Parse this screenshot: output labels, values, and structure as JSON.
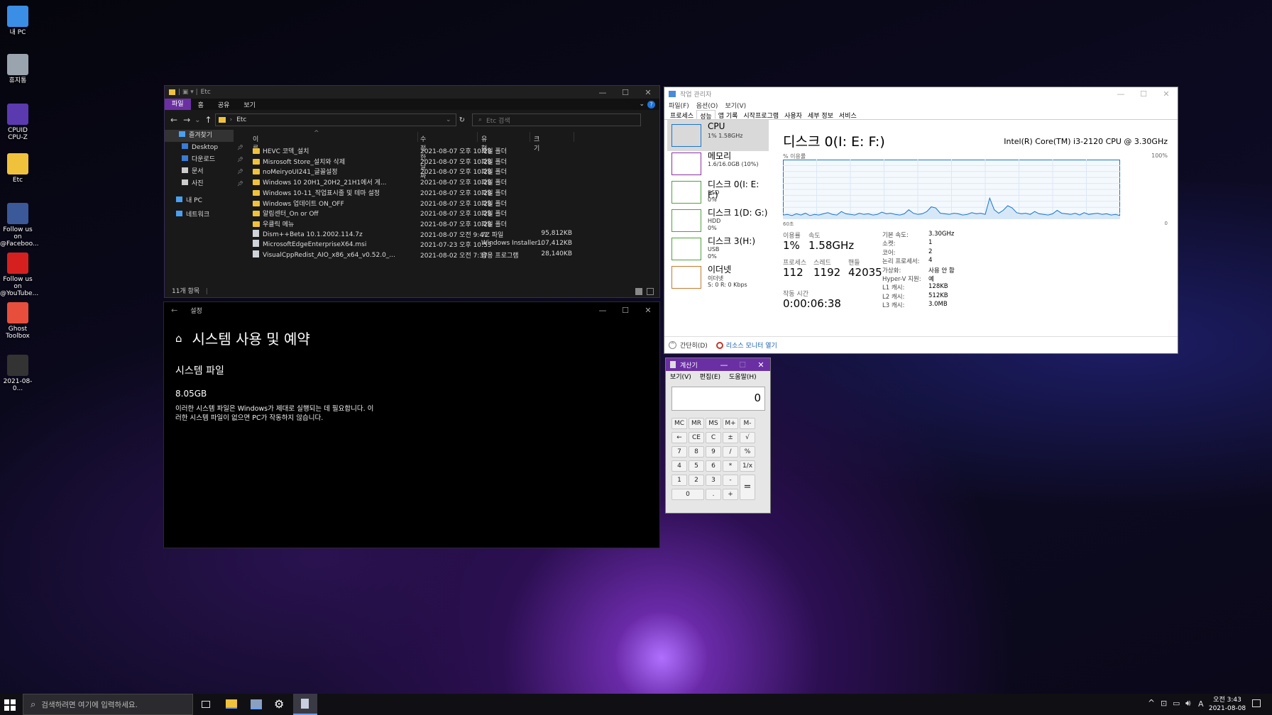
{
  "desktop": {
    "icons": [
      {
        "label": "내 PC",
        "icon": "monitor-icon",
        "color": "#3a8ee6"
      },
      {
        "label": "휴지통",
        "icon": "recycle-bin-icon",
        "color": "#9aa4ae"
      },
      {
        "label": "CPUID\nCPU-Z",
        "icon": "cpuz-icon",
        "color": "#5b3ab0"
      },
      {
        "label": "Etc",
        "icon": "folder-icon",
        "color": "#f0c23c"
      },
      {
        "label": "Follow us on\n@Faceboo...",
        "icon": "facebook-icon",
        "color": "#3b5998"
      },
      {
        "label": "Follow us on\n@YouTube...",
        "icon": "youtube-icon",
        "color": "#d62020"
      },
      {
        "label": "Ghost\nToolbox",
        "icon": "ghost-toolbox-icon",
        "color": "#e84e3c"
      },
      {
        "label": "2021-08-0...",
        "icon": "screenshot-file-icon",
        "color": "#333333"
      }
    ]
  },
  "explorer": {
    "title": "Etc",
    "ribbon": [
      "파일",
      "홈",
      "공유",
      "보기"
    ],
    "path": "Etc",
    "search_placeholder": "Etc 검색",
    "nav": [
      {
        "label": "즐겨찾기",
        "icon": "star-icon"
      },
      {
        "label": "Desktop",
        "icon": "desktop-icon"
      },
      {
        "label": "다운로드",
        "icon": "download-icon"
      },
      {
        "label": "문서",
        "icon": "document-icon"
      },
      {
        "label": "사진",
        "icon": "pictures-icon"
      },
      {
        "label": "내 PC",
        "icon": "computer-icon"
      },
      {
        "label": "네트워크",
        "icon": "network-icon"
      }
    ],
    "columns": [
      "이름",
      "수정한 날짜",
      "유형",
      "크기"
    ],
    "files": [
      {
        "name": "HEVC 코덱_설치",
        "date": "2021-08-07 오후 10:28",
        "type": "파일 폴더",
        "size": "",
        "kind": "folder"
      },
      {
        "name": "Misrosoft Store_설치와 삭제",
        "date": "2021-08-07 오후 10:28",
        "type": "파일 폴더",
        "size": "",
        "kind": "folder"
      },
      {
        "name": "noMeiryoUI241_글꼴설정",
        "date": "2021-08-07 오후 10:28",
        "type": "파일 폴더",
        "size": "",
        "kind": "folder"
      },
      {
        "name": "Windows 10 20H1_20H2_21H1에서 게...",
        "date": "2021-08-07 오후 10:28",
        "type": "파일 폴더",
        "size": "",
        "kind": "folder"
      },
      {
        "name": "Windows 10-11_작업표시줄 및 테마 설정",
        "date": "2021-08-07 오후 10:28",
        "type": "파일 폴더",
        "size": "",
        "kind": "folder"
      },
      {
        "name": "Windows 업데이트 ON_OFF",
        "date": "2021-08-07 오후 10:28",
        "type": "파일 폴더",
        "size": "",
        "kind": "folder"
      },
      {
        "name": "알림센터_On or Off",
        "date": "2021-08-07 오후 10:28",
        "type": "파일 폴더",
        "size": "",
        "kind": "folder"
      },
      {
        "name": "우클릭 메뉴",
        "date": "2021-08-07 오후 10:28",
        "type": "파일 폴더",
        "size": "",
        "kind": "folder"
      },
      {
        "name": "Dism++Beta 10.1.2002.114.7z",
        "date": "2021-08-07 오전 9:47",
        "type": "7Z 파일",
        "size": "95,812KB",
        "kind": "file"
      },
      {
        "name": "MicrosoftEdgeEnterpriseX64.msi",
        "date": "2021-07-23 오후 10:53",
        "type": "Windows Installer...",
        "size": "107,412KB",
        "kind": "file"
      },
      {
        "name": "VisualCppRedist_AIO_x86_x64_v0.52.0_...",
        "date": "2021-08-02 오전 7:37",
        "type": "응용 프로그램",
        "size": "28,140KB",
        "kind": "file"
      }
    ],
    "status": "11개 항목"
  },
  "settings": {
    "window_title": "설정",
    "page_title": "시스템 사용 및 예약",
    "section": "시스템 파일",
    "size": "8.05GB",
    "description_line1": "이러한 시스템 파일은 Windows가 제대로 실행되는 데 필요합니다. 이",
    "description_line2": "러한 시스템 파일이 없으면 PC가 작동하지 않습니다."
  },
  "taskmgr": {
    "title": "작업 관리자",
    "menu": [
      "파일(F)",
      "옵션(O)",
      "보기(V)"
    ],
    "tabs": [
      "프로세스",
      "성능",
      "앱 기록",
      "시작프로그램",
      "사용자",
      "세부 정보",
      "서비스"
    ],
    "active_tab": 1,
    "resources": [
      {
        "name": "CPU",
        "sub1": "1% 1.58GHz",
        "sub2": "",
        "color": "#1874cd"
      },
      {
        "name": "메모리",
        "sub1": "1.6/16.0GB (10%)",
        "sub2": "",
        "color": "#8b2fa3"
      },
      {
        "name": "디스크 0(I: E: F:)",
        "sub1": "SSD",
        "sub2": "0%",
        "color": "#4da33a"
      },
      {
        "name": "디스크 1(D: G:)",
        "sub1": "HDD",
        "sub2": "0%",
        "color": "#4da33a"
      },
      {
        "name": "디스크 3(H:)",
        "sub1": "USB",
        "sub2": "0%",
        "color": "#4da33a"
      },
      {
        "name": "이더넷",
        "sub1": "이더넷",
        "sub2": "S: 0 R: 0 Kbps",
        "color": "#c47a2c"
      }
    ],
    "panel_title": "디스크 0(I: E: F:)",
    "cpu_model": "Intel(R) Core(TM) i3-2120 CPU @ 3.30GHz",
    "graph_label": "% 이용률",
    "graph_max": "100%",
    "graph_time": "60초",
    "graph_min": "0",
    "graph_points": [
      6,
      7,
      5,
      8,
      6,
      9,
      5,
      7,
      6,
      8,
      10,
      7,
      6,
      12,
      8,
      7,
      6,
      9,
      7,
      8,
      6,
      7,
      11,
      8,
      9,
      7,
      6,
      8,
      15,
      9,
      7,
      8,
      12,
      20,
      18,
      9,
      8,
      7,
      9,
      8,
      6,
      7,
      10,
      8,
      9,
      7,
      35,
      15,
      9,
      14,
      22,
      18,
      10,
      8,
      9,
      7,
      12,
      8,
      7,
      6,
      8,
      14,
      9,
      8,
      7,
      9,
      6,
      10,
      7,
      8,
      9,
      7,
      8,
      6,
      7,
      5
    ],
    "stats": {
      "util_label": "이용률",
      "util": "1%",
      "speed_label": "속도",
      "speed": "1.58GHz",
      "proc_label": "프로세스",
      "proc": "112",
      "thread_label": "스레드",
      "thread": "1192",
      "handle_label": "핸들",
      "handle": "42035",
      "uptime_label": "작동 시간",
      "uptime": "0:00:06:38"
    },
    "specs": [
      {
        "k": "기본 속도:",
        "v": "3.30GHz"
      },
      {
        "k": "소켓:",
        "v": "1"
      },
      {
        "k": "코어:",
        "v": "2"
      },
      {
        "k": "논리 프로세서:",
        "v": "4"
      },
      {
        "k": "가상화:",
        "v": "사용 안 함"
      },
      {
        "k": "Hyper-V 지원:",
        "v": "예"
      },
      {
        "k": "L1 캐시:",
        "v": "128KB"
      },
      {
        "k": "L2 캐시:",
        "v": "512KB"
      },
      {
        "k": "L3 캐시:",
        "v": "3.0MB"
      }
    ],
    "footer_less": "간단히(D)",
    "footer_monitor": "리소스 모니터 열기"
  },
  "calc": {
    "title": "계산기",
    "menu": [
      "보기(V)",
      "편집(E)",
      "도움말(H)"
    ],
    "display": "0",
    "buttons": [
      [
        "MC",
        "MR",
        "MS",
        "M+",
        "M-"
      ],
      [
        "←",
        "CE",
        "C",
        "±",
        "√"
      ],
      [
        "7",
        "8",
        "9",
        "/",
        "%"
      ],
      [
        "4",
        "5",
        "6",
        "*",
        "1/x"
      ],
      [
        "1",
        "2",
        "3",
        "-",
        "="
      ],
      [
        "0",
        ".",
        "+"
      ]
    ]
  },
  "taskbar": {
    "search_placeholder": "검색하려면 여기에 입력하세요.",
    "time": "오전 3:43",
    "date": "2021-08-08",
    "ime": "A"
  }
}
